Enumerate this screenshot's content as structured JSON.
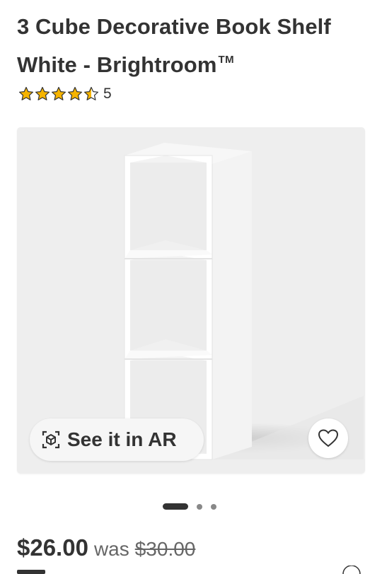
{
  "product": {
    "title_main": "3 Cube Decorative Book Shelf White - Brightroom",
    "title_tm": "TM",
    "rating_value": 4.5,
    "rating_count": "5"
  },
  "gallery": {
    "ar_label": "See it in AR",
    "active_index": 0,
    "total_images": 3
  },
  "price": {
    "current": "$26.00",
    "was_label": "was",
    "original": "$30.00"
  },
  "colors": {
    "star": "#f6b400",
    "text": "#333333",
    "card_bg": "#eeeeee"
  },
  "icons": [
    "star-icon",
    "ar-cube-icon",
    "heart-icon"
  ]
}
